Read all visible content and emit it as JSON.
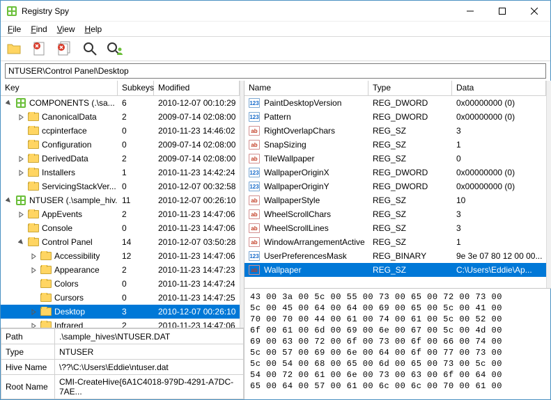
{
  "window": {
    "title": "Registry Spy"
  },
  "menus": {
    "file": "File",
    "find": "Find",
    "view": "View",
    "help": "Help"
  },
  "path": "NTUSER\\Control Panel\\Desktop",
  "tree_headers": {
    "key": "Key",
    "subkeys": "Subkeys",
    "modified": "Modified"
  },
  "tree": [
    {
      "depth": 0,
      "exp": "open",
      "icon": "hive",
      "name": "COMPONENTS (.\\sa...",
      "sub": "6",
      "mod": "2010-12-07 00:10:29"
    },
    {
      "depth": 1,
      "exp": "closed",
      "icon": "folder",
      "name": "CanonicalData",
      "sub": "2",
      "mod": "2009-07-14 02:08:00"
    },
    {
      "depth": 1,
      "exp": "none",
      "icon": "folder",
      "name": "ccpinterface",
      "sub": "0",
      "mod": "2010-11-23 14:46:02"
    },
    {
      "depth": 1,
      "exp": "none",
      "icon": "folder",
      "name": "Configuration",
      "sub": "0",
      "mod": "2009-07-14 02:08:00"
    },
    {
      "depth": 1,
      "exp": "closed",
      "icon": "folder",
      "name": "DerivedData",
      "sub": "2",
      "mod": "2009-07-14 02:08:00"
    },
    {
      "depth": 1,
      "exp": "closed",
      "icon": "folder",
      "name": "Installers",
      "sub": "1",
      "mod": "2010-11-23 14:42:24"
    },
    {
      "depth": 1,
      "exp": "none",
      "icon": "folder",
      "name": "ServicingStackVer...",
      "sub": "0",
      "mod": "2010-12-07 00:32:58"
    },
    {
      "depth": 0,
      "exp": "open",
      "icon": "hive",
      "name": "NTUSER (.\\sample_hiv...",
      "sub": "11",
      "mod": "2010-12-07 00:26:10"
    },
    {
      "depth": 1,
      "exp": "closed",
      "icon": "folder",
      "name": "AppEvents",
      "sub": "2",
      "mod": "2010-11-23 14:47:06"
    },
    {
      "depth": 1,
      "exp": "none",
      "icon": "folder",
      "name": "Console",
      "sub": "0",
      "mod": "2010-11-23 14:47:06"
    },
    {
      "depth": 1,
      "exp": "open",
      "icon": "folder",
      "name": "Control Panel",
      "sub": "14",
      "mod": "2010-12-07 03:50:28"
    },
    {
      "depth": 2,
      "exp": "closed",
      "icon": "folder",
      "name": "Accessibility",
      "sub": "12",
      "mod": "2010-11-23 14:47:06"
    },
    {
      "depth": 2,
      "exp": "closed",
      "icon": "folder",
      "name": "Appearance",
      "sub": "2",
      "mod": "2010-11-23 14:47:23"
    },
    {
      "depth": 2,
      "exp": "none",
      "icon": "folder",
      "name": "Colors",
      "sub": "0",
      "mod": "2010-11-23 14:47:24"
    },
    {
      "depth": 2,
      "exp": "none",
      "icon": "folder",
      "name": "Cursors",
      "sub": "0",
      "mod": "2010-11-23 14:47:25"
    },
    {
      "depth": 2,
      "exp": "closed",
      "icon": "folder",
      "name": "Desktop",
      "sub": "3",
      "mod": "2010-12-07 00:26:10",
      "sel": true
    },
    {
      "depth": 2,
      "exp": "closed",
      "icon": "folder",
      "name": "Infrared",
      "sub": "2",
      "mod": "2010-11-23 14:47:06"
    }
  ],
  "detail": {
    "path_lbl": "Path",
    "path": ".\\sample_hives\\NTUSER.DAT",
    "type_lbl": "Type",
    "type": "NTUSER",
    "hive_lbl": "Hive Name",
    "hive": "\\??\\C:\\Users\\Eddie\\ntuser.dat",
    "root_lbl": "Root Name",
    "root": "CMI-CreateHive{6A1C4018-979D-4291-A7DC-7AE..."
  },
  "value_headers": {
    "name": "Name",
    "type": "Type",
    "data": "Data"
  },
  "values": [
    {
      "icon": "num",
      "name": "PaintDesktopVersion",
      "type": "REG_DWORD",
      "data": "0x00000000 (0)"
    },
    {
      "icon": "num",
      "name": "Pattern",
      "type": "REG_DWORD",
      "data": "0x00000000 (0)"
    },
    {
      "icon": "str",
      "name": "RightOverlapChars",
      "type": "REG_SZ",
      "data": "3"
    },
    {
      "icon": "str",
      "name": "SnapSizing",
      "type": "REG_SZ",
      "data": "1"
    },
    {
      "icon": "str",
      "name": "TileWallpaper",
      "type": "REG_SZ",
      "data": "0"
    },
    {
      "icon": "num",
      "name": "WallpaperOriginX",
      "type": "REG_DWORD",
      "data": "0x00000000 (0)"
    },
    {
      "icon": "num",
      "name": "WallpaperOriginY",
      "type": "REG_DWORD",
      "data": "0x00000000 (0)"
    },
    {
      "icon": "str",
      "name": "WallpaperStyle",
      "type": "REG_SZ",
      "data": "10"
    },
    {
      "icon": "str",
      "name": "WheelScrollChars",
      "type": "REG_SZ",
      "data": "3"
    },
    {
      "icon": "str",
      "name": "WheelScrollLines",
      "type": "REG_SZ",
      "data": "3"
    },
    {
      "icon": "str",
      "name": "WindowArrangementActive",
      "type": "REG_SZ",
      "data": "1"
    },
    {
      "icon": "num",
      "name": "UserPreferencesMask",
      "type": "REG_BINARY",
      "data": "9e 3e 07 80 12 00 00..."
    },
    {
      "icon": "str",
      "name": "Wallpaper",
      "type": "REG_SZ",
      "data": "C:\\Users\\Eddie\\Ap...",
      "sel": true
    }
  ],
  "hex": "43 00 3a 00 5c 00 55 00 73 00 65 00 72 00 73 00\n5c 00 45 00 64 00 64 00 69 00 65 00 5c 00 41 00\n70 00 70 00 44 00 61 00 74 00 61 00 5c 00 52 00\n6f 00 61 00 6d 00 69 00 6e 00 67 00 5c 00 4d 00\n69 00 63 00 72 00 6f 00 73 00 6f 00 66 00 74 00\n5c 00 57 00 69 00 6e 00 64 00 6f 00 77 00 73 00\n5c 00 54 00 68 00 65 00 6d 00 65 00 73 00 5c 00\n54 00 72 00 61 00 6e 00 73 00 63 00 6f 00 64 00\n65 00 64 00 57 00 61 00 6c 00 6c 00 70 00 61 00"
}
